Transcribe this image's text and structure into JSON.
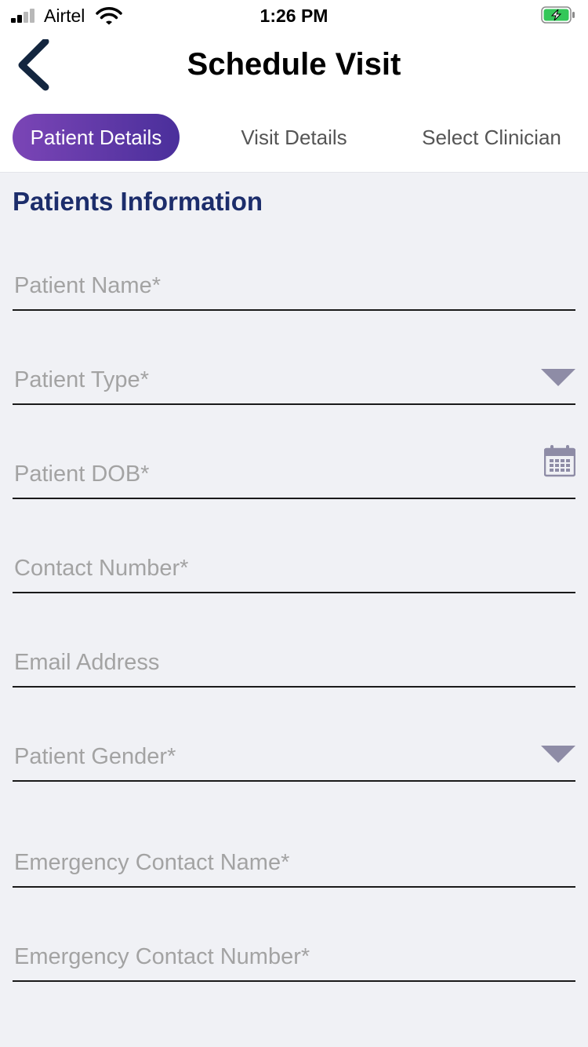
{
  "status_bar": {
    "carrier": "Airtel",
    "time": "1:26 PM",
    "icons": [
      "signal-icon",
      "wifi-icon",
      "battery-charging-icon"
    ]
  },
  "nav": {
    "title": "Schedule Visit",
    "back_icon": "chevron-left-icon"
  },
  "tabs": [
    {
      "label": "Patient Details",
      "active": true
    },
    {
      "label": "Visit Details",
      "active": false
    },
    {
      "label": "Select Clinician",
      "active": false
    }
  ],
  "section": {
    "title": "Patients Information"
  },
  "form": {
    "fields": [
      {
        "placeholder": "Patient Name*",
        "value": ""
      },
      {
        "placeholder": "Patient Type*",
        "value": "",
        "trailing_icon": "dropdown-arrow-icon"
      },
      {
        "placeholder": "Patient DOB*",
        "value": "",
        "trailing_icon": "calendar-icon"
      },
      {
        "placeholder": "Contact Number*",
        "value": ""
      },
      {
        "placeholder": "Email Address",
        "value": ""
      },
      {
        "placeholder": "Patient Gender*",
        "value": "",
        "trailing_icon": "dropdown-arrow-icon"
      },
      {
        "placeholder": "Emergency Contact Name*",
        "value": ""
      },
      {
        "placeholder": "Emergency Contact Number*",
        "value": ""
      }
    ]
  },
  "colors": {
    "tab_active_gradient_start": "#7b45b6",
    "tab_active_gradient_end": "#4a2f9b",
    "section_title": "#1c2d6b",
    "page_background": "#f0f1f5",
    "icon_gray": "#8e8ca6",
    "battery_green": "#34c759"
  }
}
